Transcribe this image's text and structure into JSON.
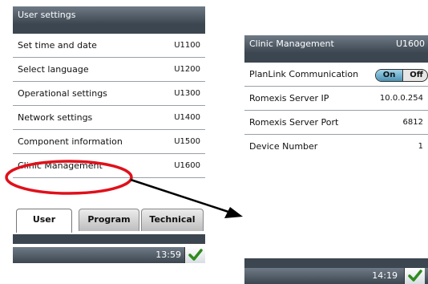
{
  "left_screen": {
    "title": "User settings",
    "rows": [
      {
        "label": "Set time and date",
        "code": "U1100"
      },
      {
        "label": "Select language",
        "code": "U1200"
      },
      {
        "label": "Operational settings",
        "code": "U1300"
      },
      {
        "label": "Network settings",
        "code": "U1400"
      },
      {
        "label": "Component information",
        "code": "U1500"
      },
      {
        "label": "Clinic Management",
        "code": "U1600"
      }
    ],
    "tabs": [
      {
        "label": "User",
        "active": true
      },
      {
        "label": "Program",
        "active": false
      },
      {
        "label": "Technical",
        "active": false
      }
    ],
    "time": "13:59",
    "ok_icon": "checkmark-icon"
  },
  "right_screen": {
    "title": "Clinic Management",
    "code": "U1600",
    "rows": [
      {
        "label": "PlanLink Communication",
        "toggle": {
          "on": "On",
          "off": "Off",
          "state": "On"
        }
      },
      {
        "label": "Romexis Server IP",
        "value": "10.0.0.254"
      },
      {
        "label": "Romexis Server Port",
        "value": "6812"
      },
      {
        "label": "Device Number",
        "value": "1"
      }
    ],
    "time": "14:19",
    "ok_icon": "checkmark-icon"
  },
  "annotation": {
    "highlight_color": "#e0101a",
    "arrow_color": "#000000"
  }
}
